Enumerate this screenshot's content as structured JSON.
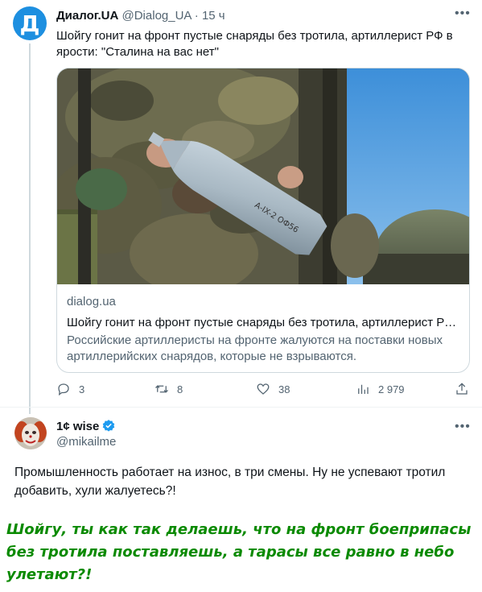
{
  "tweet": {
    "avatar_letter": "Д",
    "author_name": "Диалог.UA",
    "handle": "@Dialog_UA",
    "separator": "·",
    "time": "15 ч",
    "text": "Шойгу гонит на фронт пустые снаряды без тротила, артиллерист РФ в ярости: \"Сталина на вас нет\"",
    "card": {
      "image_marking": "А-IX-2 ОФ56",
      "domain": "dialog.ua",
      "title": "Шойгу гонит на фронт пустые снаряды без тротила, артиллерист РФ...",
      "description": "Российские артиллеристы на фронте жалуются на поставки новых артиллерийских снарядов, которые не взрываются."
    },
    "actions": {
      "replies": "3",
      "retweets": "8",
      "likes": "38",
      "views": "2 979"
    }
  },
  "reply": {
    "author_name": "1¢ wise",
    "handle": "@mikailme",
    "verified_color": "#1d9bf0",
    "text": "Промышленность работает на износ, в три смены. Ну не успевают тротил добавить,  хули жалуетесь?!"
  },
  "caption": {
    "text": "Шойгу, ты как так делаешь, что на фронт боеприпасы без тротила поставляешь, а тарасы все равно в небо улетают?!",
    "color": "#0a8a00"
  },
  "colors": {
    "secondary_text": "#536471",
    "border": "#cfd9de",
    "brand_blue": "#1d8fe0"
  }
}
